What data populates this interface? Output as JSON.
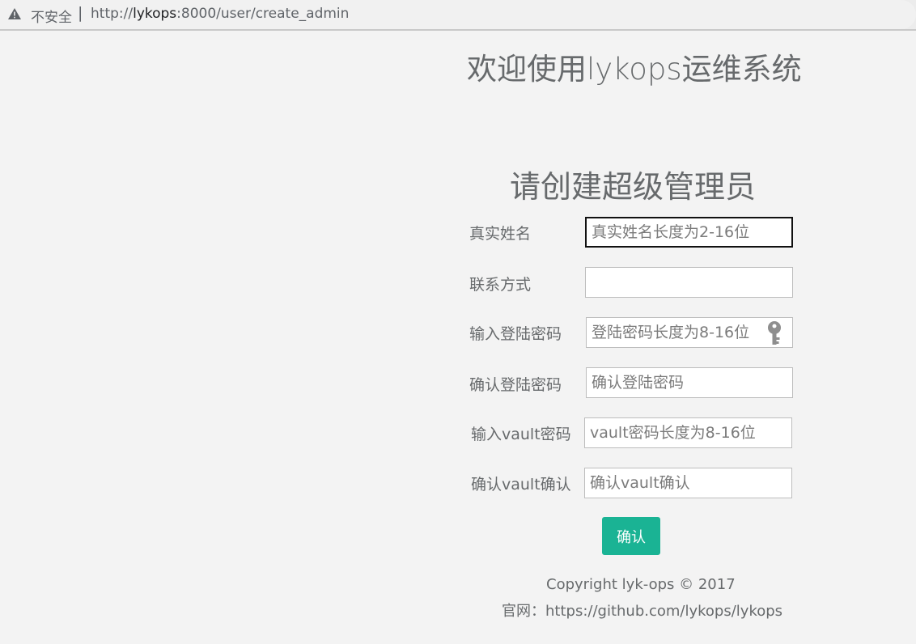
{
  "browser": {
    "security_label": "不安全",
    "separator": "|",
    "url_prefix": "http://",
    "url_host": "lykops",
    "url_rest": ":8000/user/create_admin"
  },
  "page": {
    "welcome": "欢迎使用lykops运维系统",
    "subtitle": "请创建超级管理员"
  },
  "form": {
    "real_name_label": "真实姓名",
    "real_name_placeholder": "真实姓名长度为2-16位",
    "contact_label": "联系方式",
    "contact_value": "",
    "login_password_label": "输入登陆密码",
    "login_password_placeholder": "登陆密码长度为8-16位",
    "confirm_login_password_label": "确认登陆密码",
    "confirm_login_password_placeholder": "确认登陆密码",
    "vault_password_label": "输入vault密码",
    "vault_password_placeholder": "vault密码长度为8-16位",
    "confirm_vault_label": "确认vault确认",
    "confirm_vault_placeholder": "确认vault确认",
    "submit_label": "确认"
  },
  "footer": {
    "copyright": "Copyright lyk-ops © 2017",
    "website": "官网：https://github.com/lykops/lykops"
  },
  "colors": {
    "accent": "#1ab394",
    "text": "#676a6c",
    "background": "#f3f3f3"
  },
  "icons": {
    "security": "warning-triangle-icon",
    "password": "key-icon"
  }
}
